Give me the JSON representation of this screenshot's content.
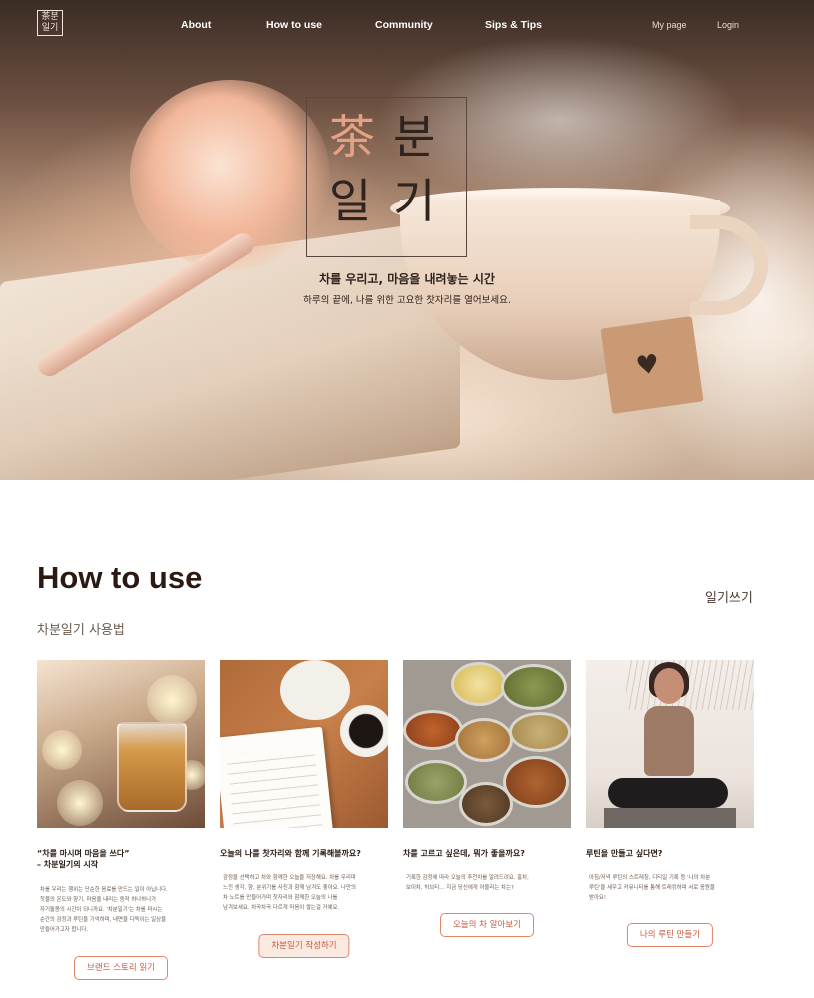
{
  "nav": {
    "logo_line1": "茶분",
    "logo_line2": "일기",
    "links": [
      "About",
      "How to use",
      "Community",
      "Sips & Tips"
    ],
    "my_page": "My page",
    "login": "Login"
  },
  "hero": {
    "brand_char1": "茶",
    "brand_char2": "분",
    "brand_char3": "일",
    "brand_char4": "기",
    "tagline": "차를 우리고, 마음을 내려놓는 시간",
    "subline": "하루의 끝에, 나를 위한 고요한 찻자리를 열어보세요.",
    "tag_icon": "heart-icon",
    "accent_color": "#e6a083"
  },
  "how_to_use": {
    "title": "How to use",
    "subtitle": "차분일기 사용법",
    "diary_link": "일기쓰기",
    "cards": [
      {
        "heading": [
          "“차를 마시며 마음을 쓰다”",
          "– 차분일기의 시작"
        ],
        "desc": [
          "차를 우리는 행위는 단순한 음료를 만드는 일이 아닙니다.",
          "찻물의 온도와 향기, 마음을 내리는 동작 하나하나가",
          "자기돌봄의 시간이 되니까요. '차분일기'는 차를 마시는",
          "순간의 감정과 루틴을 기억하며, 내면을 다독이는 일상을",
          "만들어가고자 합니다."
        ],
        "button": "브랜드 스토리 읽기"
      },
      {
        "heading": [
          "오늘의 나를 찻자리와 함께 기록해볼까요?"
        ],
        "desc": [
          "감정을 선택하고 차와 함께한 오늘을 저장해요. 차를 우리며",
          "느낀 생각, 향, 분위기를 사진과 함께 남겨도 좋아요. 나만의",
          "차 노트를 만들어가며 찻자리와 함께한 오늘의 나를",
          "남겨보세요. 차곡차곡 다르게 마음이 쌓는걸 거예요."
        ],
        "button": "차분일기 작성하기"
      },
      {
        "heading": [
          "차를 고르고 싶은데, 뭐가 좋을까요?"
        ],
        "desc": [
          "기록한 감정에 따라 오늘의 추천차를 알려드려요. 홍차,",
          "보이차, 허브티… 지금 당신에게 어울리는 차는?"
        ],
        "button": "오늘의 차 알아보기"
      },
      {
        "heading": [
          "루틴을 만들고 싶다면?"
        ],
        "desc": [
          "아침/저녁 루틴의 스트레칭, 디티일 기록 등 '나의 차분",
          "루틴'을 세우고 커뮤니티를 통해 트래킹하며 서로 응원을",
          "받아요!"
        ],
        "button": "나의 루틴 만들기"
      }
    ]
  }
}
